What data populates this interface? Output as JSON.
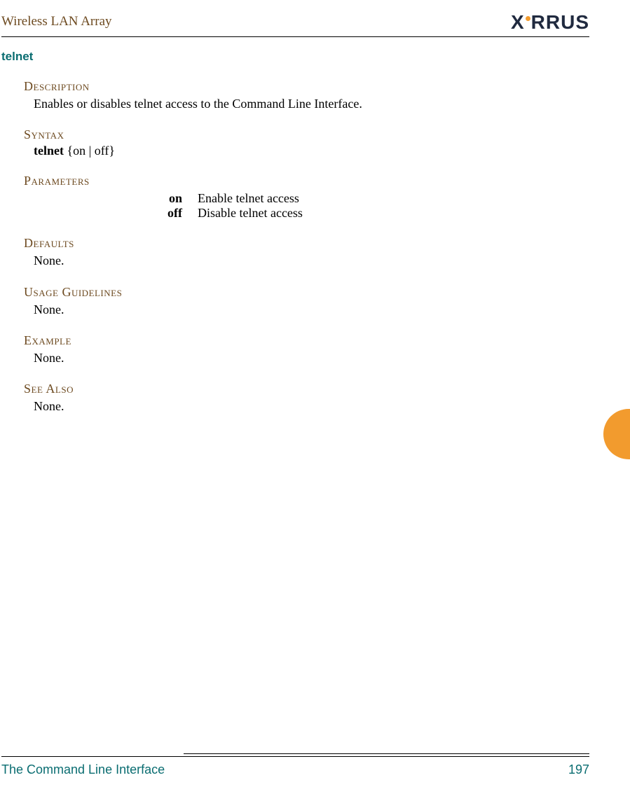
{
  "header": {
    "doc_title": "Wireless LAN Array",
    "logo_text_left": "X",
    "logo_text_right": "RRUS"
  },
  "command": {
    "name": "telnet",
    "description_label": "Description",
    "description_text": "Enables or disables telnet access to the Command Line Interface.",
    "syntax_label": "Syntax",
    "syntax_cmd": "telnet",
    "syntax_args": "  {on | off}",
    "parameters_label": "Parameters",
    "parameters": [
      {
        "name": "on",
        "desc": "Enable telnet access"
      },
      {
        "name": "off",
        "desc": "Disable telnet access"
      }
    ],
    "defaults_label": "Defaults",
    "defaults_text": "None.",
    "usage_label": "Usage Guidelines",
    "usage_text": "None.",
    "example_label": "Example",
    "example_text": "None.",
    "seealso_label": "See Also",
    "seealso_text": "None."
  },
  "footer": {
    "section": "The Command Line Interface",
    "page_number": "197"
  }
}
